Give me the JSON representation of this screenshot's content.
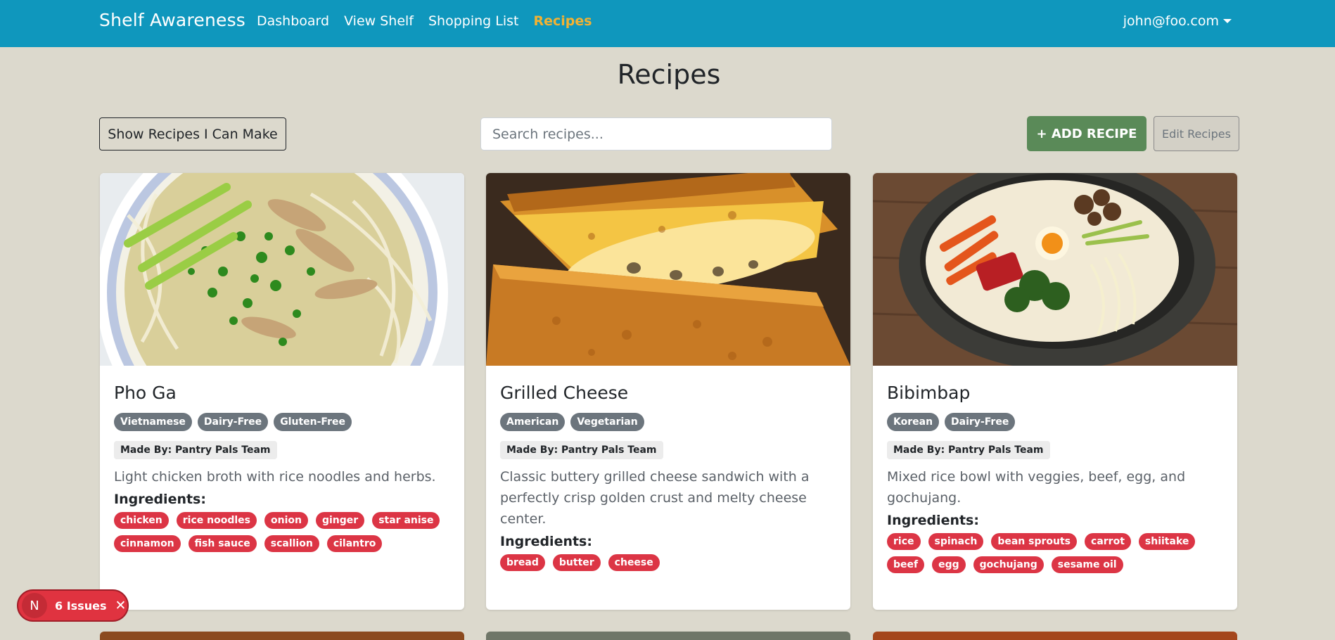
{
  "nav": {
    "brand": "Shelf Awareness",
    "links": [
      "Dashboard",
      "View Shelf",
      "Shopping List",
      "Recipes"
    ],
    "active_link": "Recipes",
    "user": "john@foo.com"
  },
  "page": {
    "title": "Recipes",
    "show_can_make_label": "Show Recipes I Can Make",
    "search_placeholder": "Search recipes...",
    "add_recipe_label": "+ ADD RECIPE",
    "edit_recipes_label": "Edit Recipes"
  },
  "recipes": [
    {
      "title": "Pho Ga",
      "tags": [
        "Vietnamese",
        "Dairy-Free",
        "Gluten-Free"
      ],
      "maker": "Made By: Pantry Pals Team",
      "description": "Light chicken broth with rice noodles and herbs.",
      "ingredients_label": "Ingredients:",
      "ingredients": [
        "chicken",
        "rice noodles",
        "onion",
        "ginger",
        "star anise",
        "cinnamon",
        "fish sauce",
        "scallion",
        "cilantro"
      ]
    },
    {
      "title": "Grilled Cheese",
      "tags": [
        "American",
        "Vegetarian"
      ],
      "maker": "Made By: Pantry Pals Team",
      "description": "Classic buttery grilled cheese sandwich with a perfectly crisp golden crust and melty cheese center.",
      "ingredients_label": "Ingredients:",
      "ingredients": [
        "bread",
        "butter",
        "cheese"
      ]
    },
    {
      "title": "Bibimbap",
      "tags": [
        "Korean",
        "Dairy-Free"
      ],
      "maker": "Made By: Pantry Pals Team",
      "description": "Mixed rice bowl with veggies, beef, egg, and gochujang.",
      "ingredients_label": "Ingredients:",
      "ingredients": [
        "rice",
        "spinach",
        "bean sprouts",
        "carrot",
        "shiitake",
        "beef",
        "egg",
        "gochujang",
        "sesame oil"
      ]
    }
  ],
  "issues_badge": {
    "avatar_letter": "N",
    "label": "6 Issues",
    "close": "✕"
  },
  "colors": {
    "navbar": "#0f97bd",
    "active_link": "#f2b233",
    "add_button": "#5a8a58",
    "ingredient_pill": "#dc3545",
    "tag_pill": "#6c757d"
  }
}
